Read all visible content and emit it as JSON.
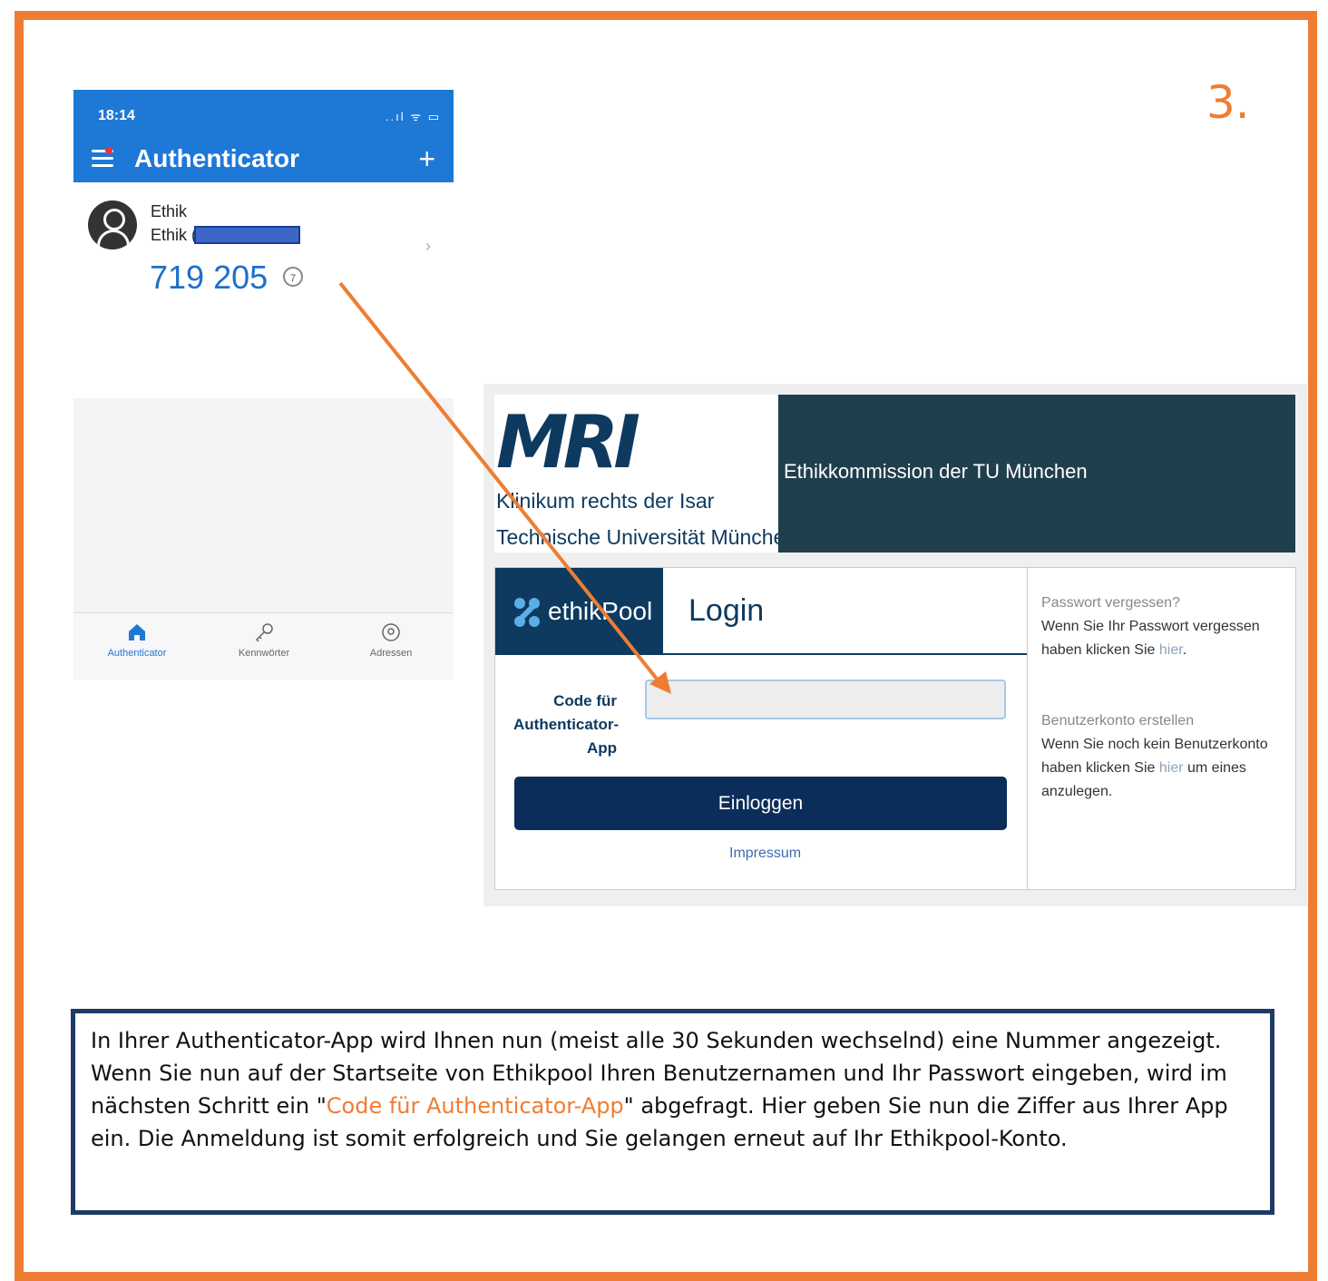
{
  "step_number": "3.",
  "phone": {
    "status_time": "18:14",
    "status_icons": "..ıl ᯤ ▭",
    "app_title": "Authenticator",
    "add_icon": "plus-icon",
    "account_line1": "Ethik",
    "account_line2": "Ethik (",
    "code": "719 205",
    "timer_seconds": "7",
    "chevron": "›",
    "tabs": [
      {
        "label": "Authenticator",
        "icon": "home-icon",
        "active": true
      },
      {
        "label": "Kennwörter",
        "icon": "key-icon",
        "active": false
      },
      {
        "label": "Adressen",
        "icon": "location-icon",
        "active": false
      }
    ]
  },
  "web": {
    "logo": "MRI",
    "header_line1": "Klinikum rechts der Isar",
    "header_line2": "Technische Universität München",
    "commission": "Ethikkommission der TU München",
    "brand": "ethikPool",
    "login_title": "Login",
    "code_label": "Code für Authenticator-App",
    "login_button": "Einloggen",
    "impressum": "Impressum",
    "forgot": {
      "heading": "Passwort vergessen?",
      "text_before": "Wenn Sie Ihr Passwort vergessen haben klicken Sie ",
      "link": "hier",
      "text_after": "."
    },
    "register": {
      "heading": "Benutzerkonto erstellen",
      "text_before": "Wenn Sie noch kein Benutzerkonto haben klicken Sie ",
      "link": "hier",
      "text_after": " um eines anzulegen."
    }
  },
  "colors": {
    "accent_orange": "#ee7d33",
    "app_blue": "#1e78d6",
    "navy": "#0b2d59",
    "box_border": "#203a66"
  },
  "instructions": {
    "part1": "In Ihrer Authenticator-App wird Ihnen nun (meist alle 30 Sekunden wechselnd) eine Nummer angezeigt. Wenn Sie nun auf der Startseite von Ethikpool Ihren Benutzernamen und Ihr Passwort eingeben, wird im nächsten Schritt ein \"",
    "highlight": "Code für Authenticator-App",
    "part2": "\" abgefragt. Hier geben Sie nun die Ziffer aus Ihrer App ein. Die Anmeldung ist somit erfolgreich und Sie gelangen erneut auf Ihr Ethikpool-Konto."
  }
}
